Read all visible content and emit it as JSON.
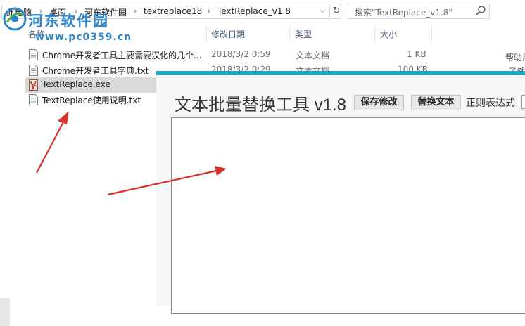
{
  "explorer": {
    "breadcrumb": [
      "此电脑",
      "桌面",
      "河东软件园",
      "textreplace18",
      "TextReplace_v1.8"
    ],
    "search_placeholder": "搜索\"TextReplace_v1.8\"",
    "columns": {
      "name": "名称",
      "modified": "修改日期",
      "type": "类型",
      "size": "大小"
    },
    "files": [
      {
        "name": "Chrome开发者工具主要需要汉化的几个...",
        "modified": "2018/3/2 0:59",
        "type": "文本文档",
        "size": "1 KB",
        "icon": "text-file-icon"
      },
      {
        "name": "Chrome开发者工具字典.txt",
        "modified": "2018/3/2 0:29",
        "type": "文本文档",
        "size": "100 KB",
        "icon": "text-file-icon"
      },
      {
        "name": "TextReplace.exe",
        "icon": "exe-file-icon",
        "selected": true
      },
      {
        "name": "TextReplace使用说明.txt",
        "icon": "text-file-icon"
      }
    ],
    "edge_fragments": [
      "帮助用户",
      "了然，"
    ]
  },
  "watermark": {
    "title": "河东软件园",
    "url": "www.pc0359.cn"
  },
  "app": {
    "title": "文本批量替换工具 v1.8",
    "save_button": "保存修改",
    "replace_button": "替换文本",
    "regex_label": "正则表达式"
  },
  "colors": {
    "app_title_bar": "#1ba8c8",
    "watermark": "#2f86c9",
    "annotation_arrow": "#d9302a",
    "selected_row": "#d9d9d9"
  }
}
